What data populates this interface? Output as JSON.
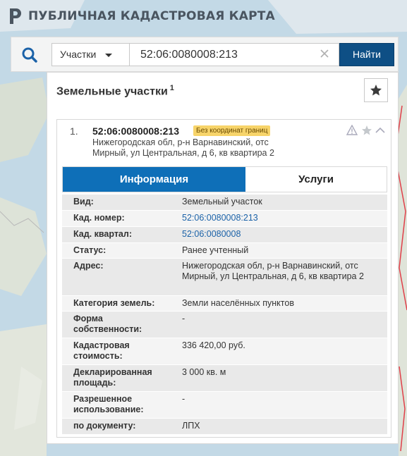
{
  "header": {
    "title": "ПУБЛИЧНАЯ КАДАСТРОВАЯ КАРТА"
  },
  "search": {
    "type_label": "Участки",
    "query": "52:06:0080008:213",
    "find_label": "Найти"
  },
  "results": {
    "title": "Земельные участки",
    "count": "1",
    "item": {
      "number": "1.",
      "cad_number": "52:06:0080008:213",
      "badge": "Без координат границ",
      "address": "Нижегородская обл, р-н Варнавинский, отс Мирный, ул Центральная, д 6, кв квартира 2"
    },
    "tabs": [
      {
        "label": "Информация"
      },
      {
        "label": "Услуги"
      }
    ],
    "properties": [
      {
        "key": "Вид:",
        "value": "Земельный участок"
      },
      {
        "key": "Кад. номер:",
        "value": "52:06:0080008:213"
      },
      {
        "key": "Кад. квартал:",
        "value": "52:06:0080008"
      },
      {
        "key": "Статус:",
        "value": "Ранее учтенный"
      },
      {
        "key": "Адрес:",
        "value": "Нижегородская обл, р-н Варнавинский, отс Мирный, ул Центральная, д 6, кв квартира 2"
      },
      {
        "key": "Категория земель:",
        "value": "Земли населённых пунктов"
      },
      {
        "key": "Форма собственности:",
        "value": "-"
      },
      {
        "key": "Кадастровая стоимость:",
        "value": "336 420,00 руб."
      },
      {
        "key": "Декларированная площадь:",
        "value": "3 000 кв. м"
      },
      {
        "key": "Разрешенное использование:",
        "value": "-"
      },
      {
        "key": "по документу:",
        "value": "ЛПХ"
      }
    ]
  },
  "colors": {
    "accent": "#0e4f85",
    "tab_active": "#0e6fb8",
    "badge": "#f7d46a",
    "link": "#1b62a8"
  }
}
